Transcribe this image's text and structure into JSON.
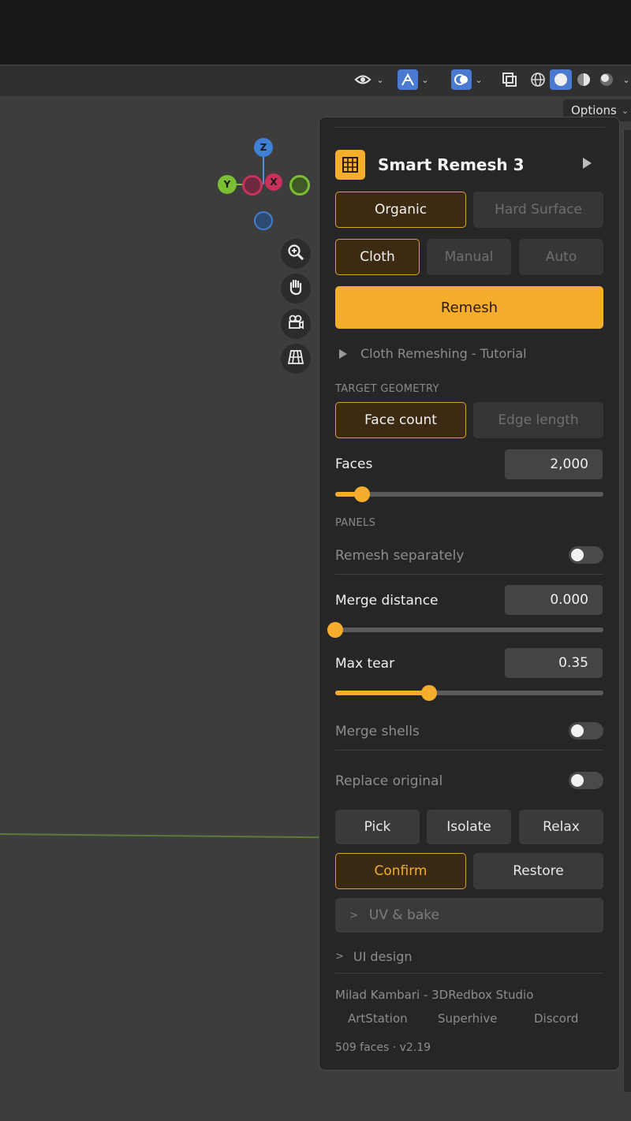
{
  "colors": {
    "accent": "#f5ad2b",
    "accent_dark": "#3d2a12",
    "panel_bg": "#262626",
    "viewport_bg": "#3d3d3d",
    "gizmo_z": "#3f7fd4",
    "gizmo_y": "#7bbf32",
    "gizmo_x": "#c8325a"
  },
  "header": {
    "options_label": "Options",
    "icons": [
      "visibility-icon",
      "gizmo-toggle-icon",
      "overlay-icon",
      "xray-icon",
      "wireframe-shading-icon",
      "solid-shading-icon",
      "material-shading-icon",
      "rendered-shading-icon"
    ]
  },
  "gizmo": {
    "z": "Z",
    "y": "Y",
    "x": "X"
  },
  "nav_icons": [
    "zoom-icon",
    "pan-hand-icon",
    "camera-icon",
    "perspective-grid-icon"
  ],
  "panel": {
    "title": "Smart Remesh 3",
    "mode_tabs": {
      "organic": "Organic",
      "hard_surface": "Hard Surface"
    },
    "sub_tabs": {
      "cloth": "Cloth",
      "manual": "Manual",
      "auto": "Auto"
    },
    "remesh_label": "Remesh",
    "tutorial_label": "Cloth Remeshing - Tutorial",
    "target_geometry_label": "TARGET GEOMETRY",
    "target_tabs": {
      "face_count": "Face count",
      "edge_length": "Edge length"
    },
    "faces": {
      "label": "Faces",
      "value": "2,000",
      "level": 0.1
    },
    "panels_label": "PANELS",
    "remesh_separately": {
      "label": "Remesh separately",
      "on": false
    },
    "merge_distance": {
      "label": "Merge distance",
      "value": "0.000",
      "level": 0.0
    },
    "max_tear": {
      "label": "Max tear",
      "value": "0.35",
      "level": 0.35
    },
    "merge_shells": {
      "label": "Merge shells",
      "on": false
    },
    "replace_original": {
      "label": "Replace original",
      "on": false
    },
    "actions": {
      "pick": "Pick",
      "isolate": "Isolate",
      "relax": "Relax"
    },
    "confirm_label": "Confirm",
    "restore_label": "Restore",
    "uv_bake_label": "UV & bake",
    "ui_design_label": "UI design",
    "credits": "Milad Kambari - 3DRedbox Studio",
    "links": {
      "artstation": "ArtStation",
      "superhive": "Superhive",
      "discord": "Discord"
    },
    "status": "509 faces · v2.19"
  }
}
